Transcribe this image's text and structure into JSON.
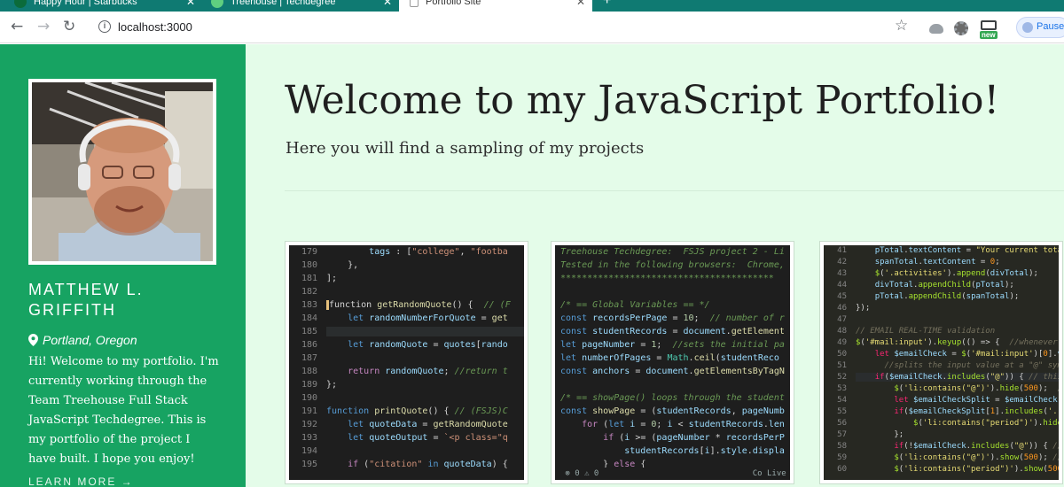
{
  "browser": {
    "tabs": [
      {
        "title": "Happy Hour | Starbucks",
        "favicon_color": "#0b6b3a"
      },
      {
        "title": "Treehouse | Techdegree",
        "favicon_color": "#5fcf80"
      },
      {
        "title": "Portfolio Site",
        "favicon_color": "#ffffff"
      }
    ],
    "url": "localhost:3000",
    "profile_status": "Paused",
    "extension_badge": "new",
    "tab_strip_color": "#0f7a72"
  },
  "sidebar": {
    "background": "#17a362",
    "name": "MATTHEW L. GRIFFITH",
    "location": "Portland, Oregon",
    "bio": "Hi! Welcome to my portfolio. I'm currently working through the Team Treehouse Full Stack JavaScript Techdegree. This is my portfolio of the project I have built. I hope you enjoy!",
    "learn_more": "LEARN MORE →"
  },
  "main": {
    "background": "#e4fce9",
    "title": "Welcome to my JavaScript Portfolio!",
    "subtitle": "Here you will find a sampling of my projects"
  },
  "projects": [
    {
      "line_numbers": [
        "179",
        "180",
        "181",
        "182",
        "183",
        "184",
        "185",
        "186",
        "187",
        "188",
        "189",
        "190",
        "191",
        "192",
        "193",
        "194",
        "195"
      ]
    },
    {
      "header_lines": [
        "Treehouse Techdegree:  FSJS project 2 - Li",
        "Tested in the following browsers:  Chrome,"
      ]
    },
    {
      "line_numbers": [
        "41",
        "42",
        "43",
        "44",
        "45",
        "46",
        "47",
        "48",
        "49",
        "50",
        "51",
        "52",
        "53",
        "54",
        "55",
        "56",
        "57",
        "58",
        "59",
        "60"
      ]
    }
  ]
}
